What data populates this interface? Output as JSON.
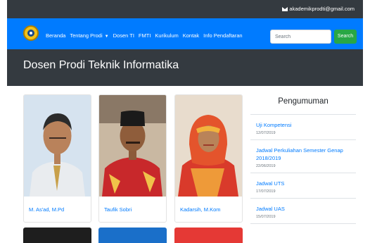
{
  "topbar": {
    "email": "akademikprodti@gmail.com",
    "email_icon": "envelope-icon"
  },
  "navbar": {
    "logo": "university-logo",
    "menu": [
      {
        "label": "Beranda"
      },
      {
        "label": "Tentang Prodi",
        "dropdown": true
      },
      {
        "label": "Dosen TI"
      },
      {
        "label": "FMTI"
      },
      {
        "label": "Kurikulum"
      },
      {
        "label": "Kontak"
      },
      {
        "label": "Info Pendaftaran"
      }
    ],
    "search_placeholder": "Search",
    "search_button": "Search",
    "colors": {
      "navbar": "#007bff",
      "search_button": "#28a745"
    }
  },
  "banner": {
    "title": "Dosen Prodi Teknik Informatika"
  },
  "lecturers": [
    {
      "name": "M. As'ad, M.Pd"
    },
    {
      "name": "Taufik Sobri"
    },
    {
      "name": "Kadarsih, M.Kom"
    }
  ],
  "announcements": {
    "title": "Pengumuman",
    "items": [
      {
        "title": "Uji Kompetensi",
        "date": "12/07/2019"
      },
      {
        "title": "Jadwal Perkuliahan Semester Genap 2018/2019",
        "date": "22/06/2019"
      },
      {
        "title": "Jadwal UTS",
        "date": "17/07/2019"
      },
      {
        "title": "Jadwal UAS",
        "date": "15/07/2019"
      }
    ]
  }
}
